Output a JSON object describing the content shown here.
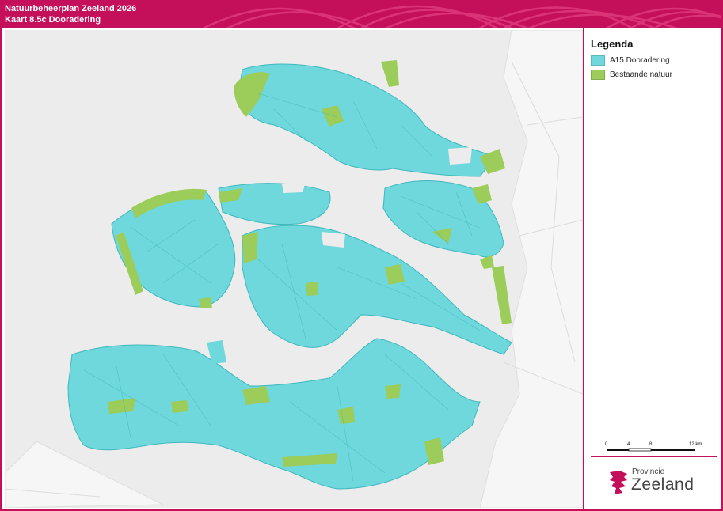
{
  "header": {
    "title": "Natuurbeheerplan Zeeland 2026",
    "subtitle": "Kaart 8.5c Dooradering"
  },
  "colors": {
    "brand": "#c4105b",
    "dooradering": "#6ed8dc",
    "natuur": "#9ccc5a",
    "water": "#ececec"
  },
  "legend": {
    "title": "Legenda",
    "items": [
      {
        "label": "A15 Dooradering",
        "color": "#6ed8dc"
      },
      {
        "label": "Bestaande natuur",
        "color": "#9ccc5a"
      }
    ]
  },
  "scale": {
    "ticks": [
      "0",
      "4",
      "8",
      "12 km"
    ]
  },
  "logo": {
    "small": "Provincie",
    "big": "Zeeland"
  }
}
